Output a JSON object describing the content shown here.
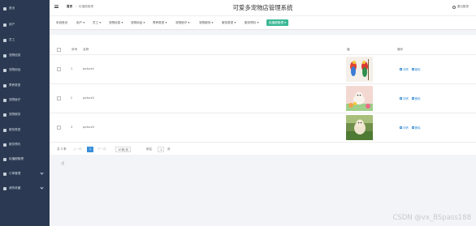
{
  "sidebar": {
    "items": [
      {
        "label": "首页",
        "icon": "home-icon"
      },
      {
        "label": "用户",
        "icon": "user-icon"
      },
      {
        "label": "员工",
        "icon": "staff-icon"
      },
      {
        "label": "宠物信息",
        "icon": "grid-icon"
      },
      {
        "label": "宠物用品",
        "icon": "grid-icon"
      },
      {
        "label": "寄养类型",
        "icon": "grid-icon"
      },
      {
        "label": "宠物医疗",
        "icon": "grid-icon"
      },
      {
        "label": "宠物服务",
        "icon": "grid-icon"
      },
      {
        "label": "服务类型",
        "icon": "grid-icon"
      },
      {
        "label": "服务预约",
        "icon": "grid-icon"
      },
      {
        "label": "轮播图管理",
        "icon": "grid-icon"
      },
      {
        "label": "订单管理",
        "icon": "grid-icon",
        "expandable": true
      },
      {
        "label": "我的收藏",
        "icon": "grid-icon",
        "expandable": true
      }
    ]
  },
  "header": {
    "breadcrumb_home": "首页",
    "breadcrumb_sep": "/",
    "breadcrumb_current": "轮播图管理",
    "title": "可爱多宠物店管理系统",
    "logout": "退出登录"
  },
  "menubar": {
    "items": [
      {
        "label": "系统首页"
      },
      {
        "label": "用户 ▾"
      },
      {
        "label": "员工 ▾"
      },
      {
        "label": "宠物信息 ▾"
      },
      {
        "label": "宠物用品 ▾"
      },
      {
        "label": "寄养类型 ▾"
      },
      {
        "label": "宠物医疗 ▾"
      },
      {
        "label": "宠物服务 ▾"
      },
      {
        "label": "服务类型 ▾"
      },
      {
        "label": "服务预约 ▾"
      },
      {
        "label": "轮播图管理 ▾",
        "active": true
      }
    ]
  },
  "table": {
    "headers": {
      "index": "序号",
      "name": "名称",
      "value": "值",
      "actions": "操作"
    },
    "rows": [
      {
        "index": "1",
        "name": "picture1",
        "image": "birds"
      },
      {
        "index": "2",
        "name": "picture2",
        "image": "dog-flowers"
      },
      {
        "index": "3",
        "name": "picture3",
        "image": "dog-grass"
      }
    ],
    "detail_label": "详情",
    "delete_label": "删除"
  },
  "pagination": {
    "total": "共 3 条",
    "prev": "上一页",
    "page": "1",
    "next": "下一页",
    "page_size": "10条/页",
    "goto_label": "前往",
    "goto_value": "1",
    "page_suffix": "页"
  },
  "watermark": "CSDN @vx_BSpass188",
  "colors": {
    "sidebar": "#2b3a52",
    "accent": "#3cb896",
    "link": "#3a8fd9"
  }
}
